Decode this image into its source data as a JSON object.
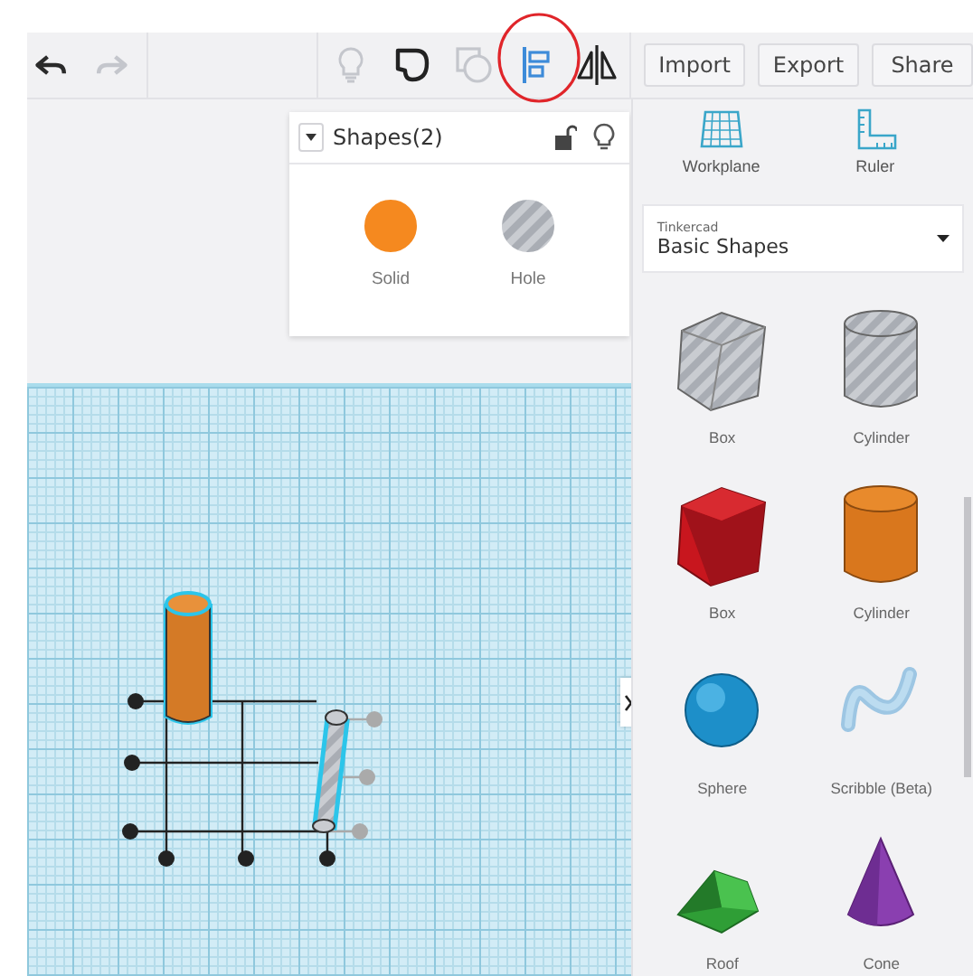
{
  "toolbar": {
    "history": [
      {
        "kind": "undo",
        "disabled": false
      },
      {
        "kind": "redo",
        "disabled": true
      }
    ],
    "tools": [
      {
        "kind": "notes",
        "disabled": true,
        "active": false
      },
      {
        "kind": "group",
        "disabled": false,
        "active": false
      },
      {
        "kind": "ungroup",
        "disabled": true,
        "active": false
      },
      {
        "kind": "align",
        "disabled": false,
        "active": true
      },
      {
        "kind": "mirror",
        "disabled": false,
        "active": false
      }
    ],
    "buttons": [
      {
        "label": "Import"
      },
      {
        "label": "Export"
      },
      {
        "label": "Share"
      }
    ]
  },
  "shapes_panel": {
    "title": "Shapes(2)",
    "options": [
      {
        "label": "Solid",
        "kind": "solid"
      },
      {
        "label": "Hole",
        "kind": "hole"
      }
    ]
  },
  "side_tools": [
    {
      "label": "Workplane",
      "kind": "workplane"
    },
    {
      "label": "Ruler",
      "kind": "ruler"
    }
  ],
  "library": {
    "provider": "Tinkercad",
    "category": "Basic Shapes"
  },
  "shapes": [
    {
      "label": "Box",
      "kind": "box-hole"
    },
    {
      "label": "Cylinder",
      "kind": "cylinder-hole"
    },
    {
      "label": "Box",
      "kind": "box"
    },
    {
      "label": "Cylinder",
      "kind": "cylinder"
    },
    {
      "label": "Sphere",
      "kind": "sphere"
    },
    {
      "label": "Scribble (Beta)",
      "kind": "scribble"
    },
    {
      "label": "Roof",
      "kind": "roof"
    },
    {
      "label": "Cone",
      "kind": "cone"
    }
  ]
}
